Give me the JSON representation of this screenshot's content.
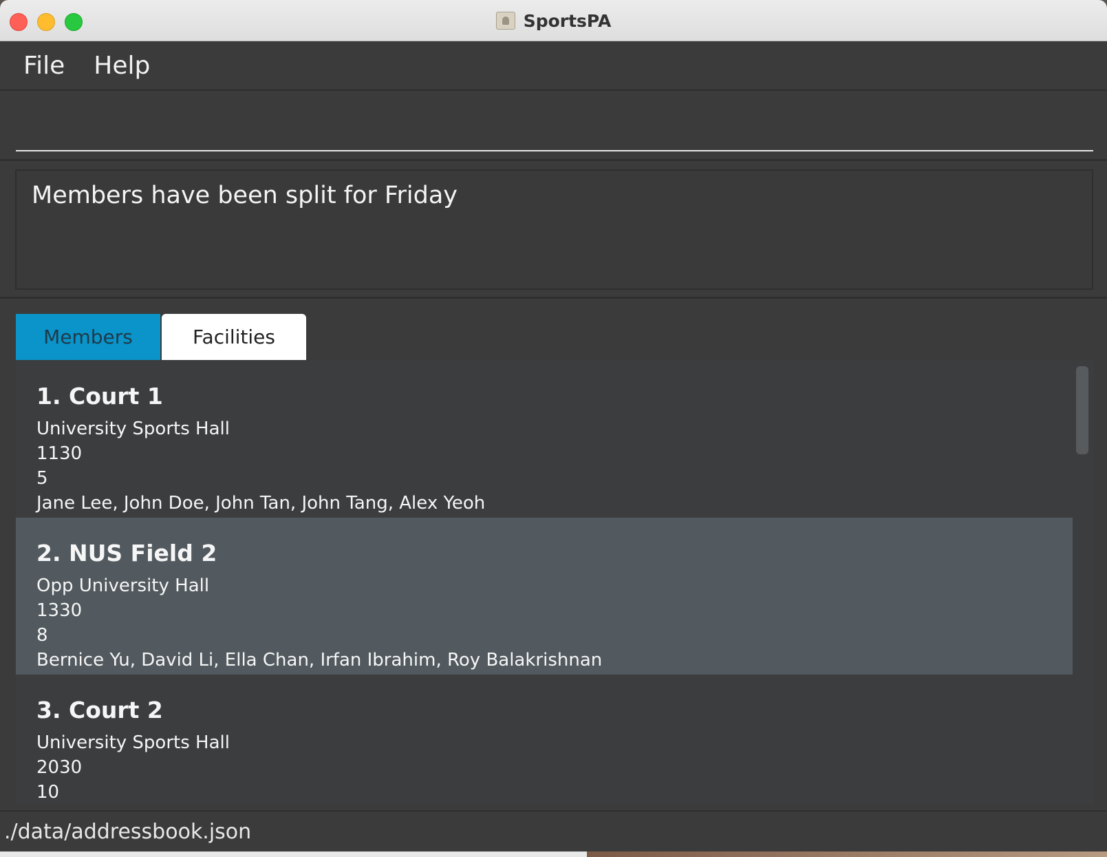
{
  "window": {
    "title": "SportsPA"
  },
  "menu": {
    "items": [
      "File",
      "Help"
    ]
  },
  "command": {
    "value": ""
  },
  "result": {
    "message": "Members have been split for Friday"
  },
  "tabs": [
    {
      "label": "Members",
      "active": true
    },
    {
      "label": "Facilities",
      "active": false
    }
  ],
  "facilities": [
    {
      "title": "1. Court 1",
      "location": "University Sports Hall",
      "time": "1130",
      "capacity": "5",
      "members": "Jane Lee, John Doe, John Tan, John Tang, Alex Yeoh"
    },
    {
      "title": "2. NUS Field 2",
      "location": "Opp University Hall",
      "time": "1330",
      "capacity": "8",
      "members": "Bernice Yu, David Li, Ella Chan, Irfan Ibrahim, Roy Balakrishnan"
    },
    {
      "title": "3. Court 2",
      "location": "University Sports Hall",
      "time": "2030",
      "capacity": "10",
      "members": ""
    }
  ],
  "status": {
    "path": "./data/addressbook.json"
  },
  "colors": {
    "accent_tab": "#0a94c9",
    "selected_card": "#525a5f",
    "background": "#3b3b3b"
  }
}
